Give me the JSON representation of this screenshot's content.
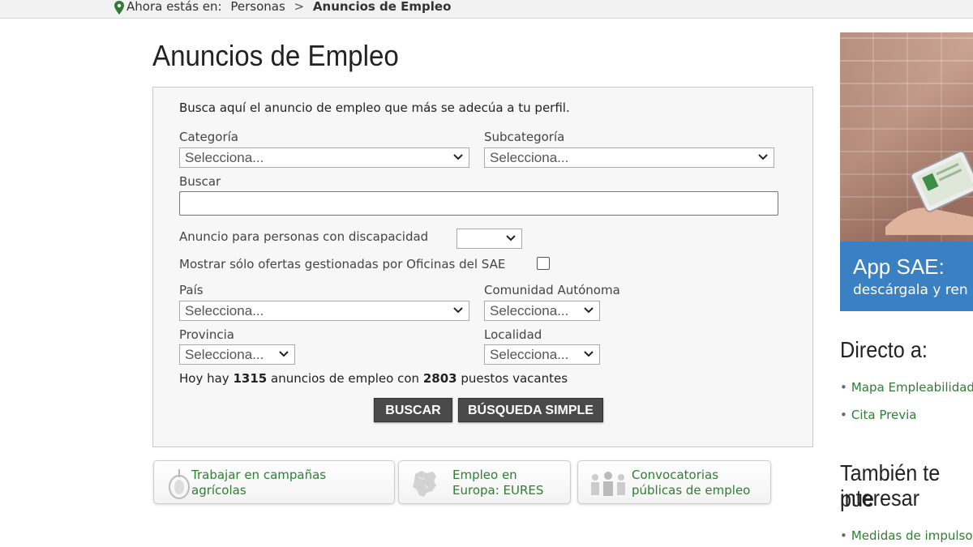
{
  "breadcrumb": {
    "prefix": "Ahora estás en:",
    "parent": "Personas",
    "separator": ">",
    "current": "Anuncios de Empleo"
  },
  "page": {
    "title": "Anuncios de Empleo"
  },
  "form": {
    "intro": "Busca aquí el anuncio de empleo que más se adecúa a tu perfil.",
    "categoria": {
      "label": "Categoría",
      "value": "Selecciona..."
    },
    "subcategoria": {
      "label": "Subcategoría",
      "value": "Selecciona..."
    },
    "buscar": {
      "label": "Buscar",
      "value": ""
    },
    "discapacidad": {
      "label": "Anuncio para personas con discapacidad",
      "value": ""
    },
    "sae_only": {
      "label": "Mostrar sólo ofertas gestionadas por Oficinas del SAE",
      "checked": false
    },
    "pais": {
      "label": "País",
      "value": "Selecciona..."
    },
    "comunidad": {
      "label": "Comunidad Autónoma",
      "value": "Selecciona..."
    },
    "provincia": {
      "label": "Provincia",
      "value": "Selecciona..."
    },
    "localidad": {
      "label": "Localidad",
      "value": "Selecciona..."
    },
    "summary": {
      "prefix": "Hoy hay",
      "ads": "1315",
      "middle": "anuncios de empleo con",
      "vacancies": "2803",
      "suffix": "puestos vacantes"
    },
    "buttons": {
      "search": "BUSCAR",
      "simple": "BÚSQUEDA SIMPLE"
    }
  },
  "cards": [
    {
      "label": "Trabajar en campañas agrícolas",
      "icon": "wheat-icon"
    },
    {
      "label": "Empleo en Europa: EURES",
      "icon": "europe-map-icon"
    },
    {
      "label": "Convocatorias públicas de empleo",
      "icon": "people-icon"
    }
  ],
  "sidebar": {
    "promo": {
      "title": "App SAE:",
      "subtitle": "descárgala y ren"
    },
    "directo": {
      "heading": "Directo a:",
      "links": [
        "Mapa Empleabilidad",
        "Cita Previa"
      ]
    },
    "tambien": {
      "heading_line1": "También te pue",
      "heading_line2": "interesar",
      "links": [
        "Medidas de impulso"
      ]
    }
  },
  "colors": {
    "link_green": "#2f7d32",
    "button_dark": "#4a4a4a",
    "banner_blue": "#3b80c3"
  }
}
